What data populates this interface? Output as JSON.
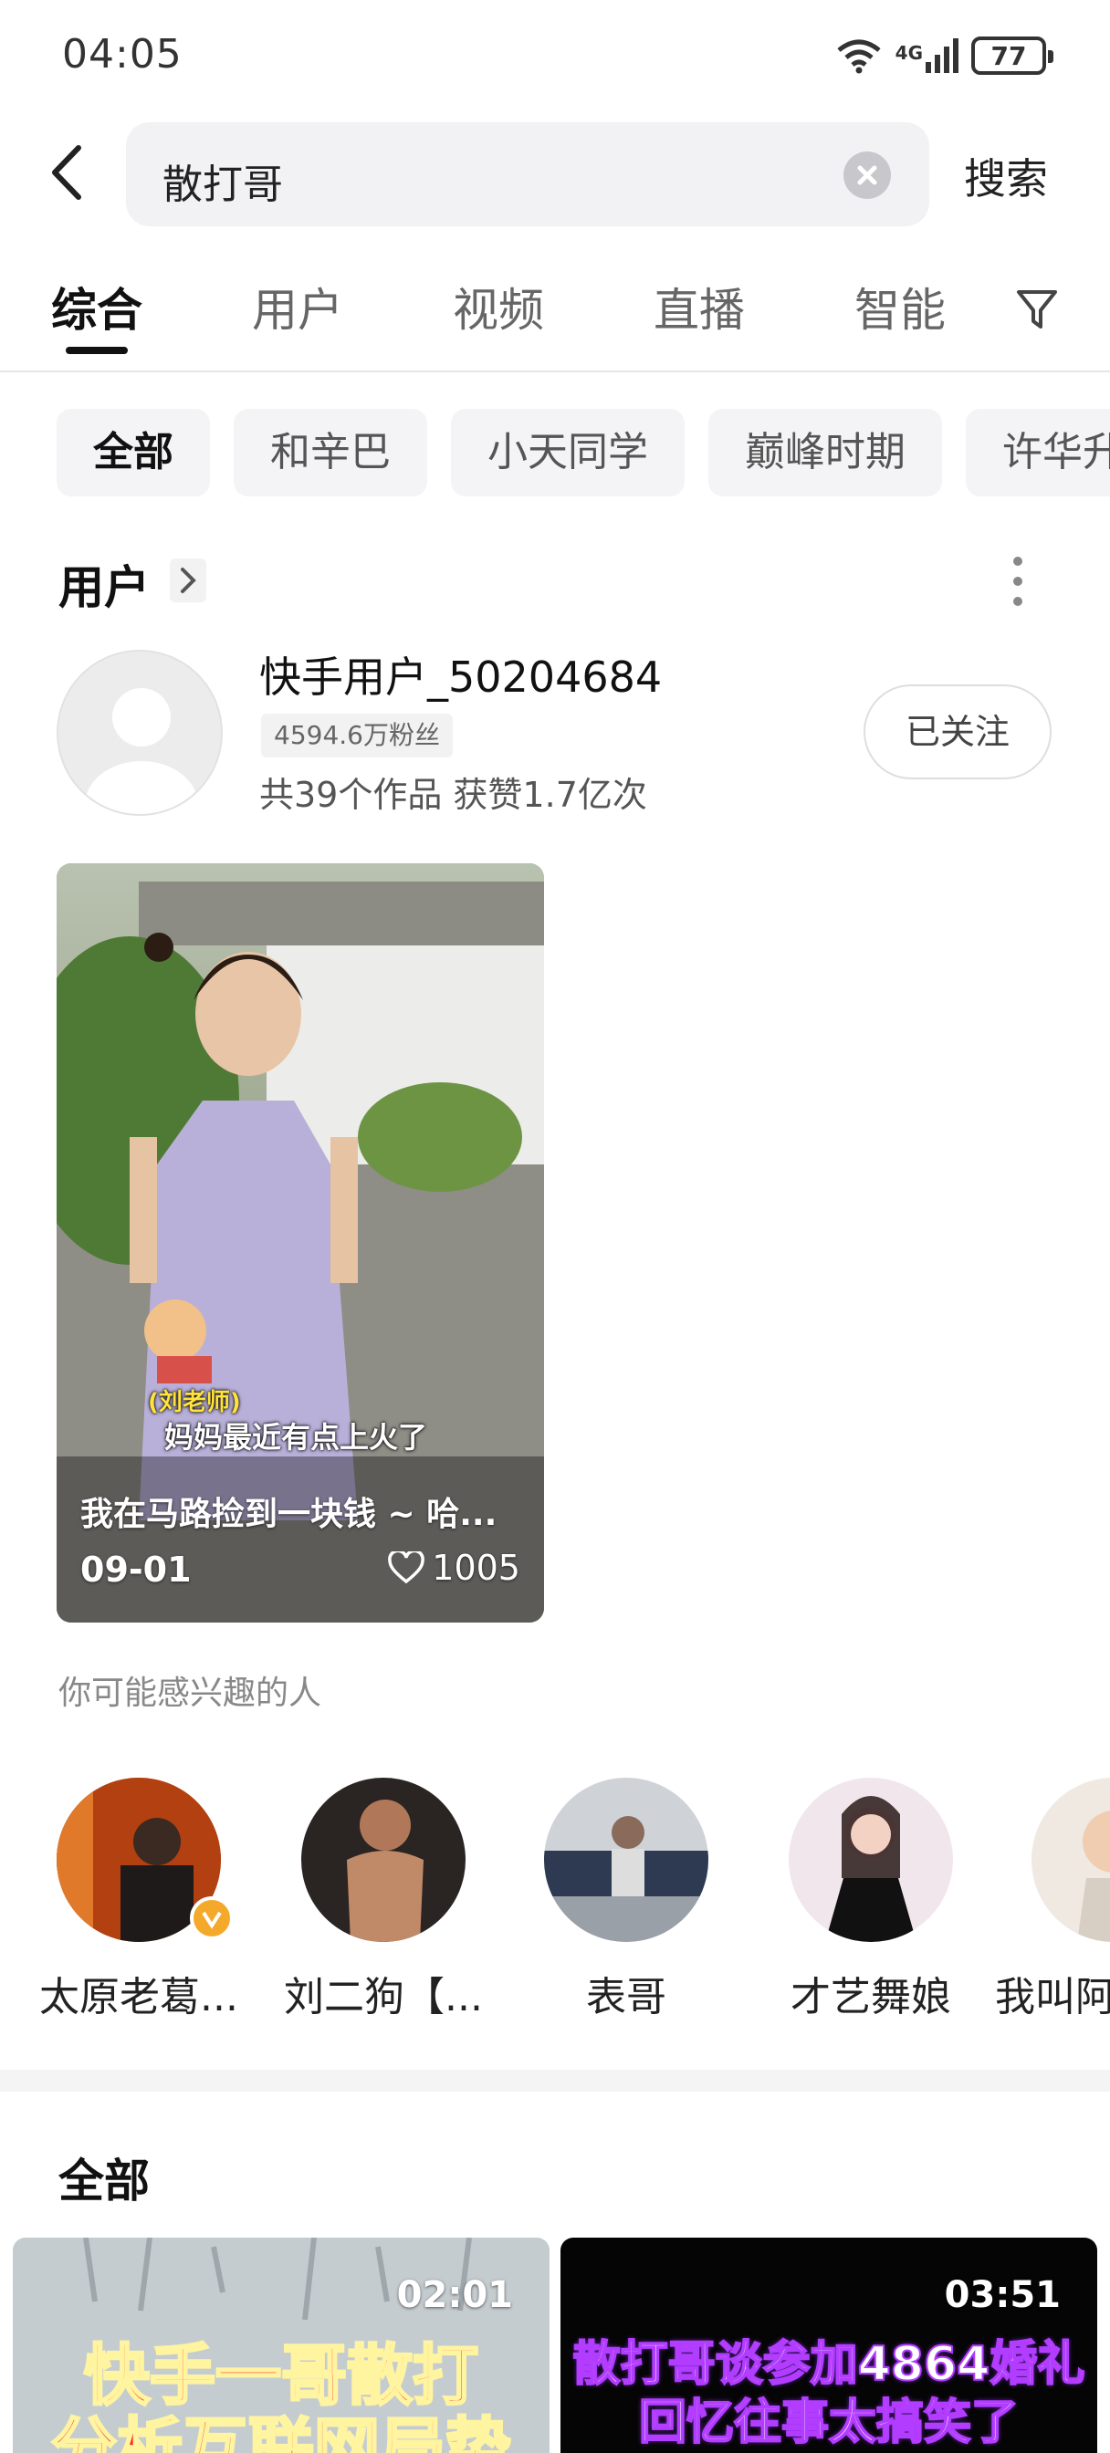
{
  "status_bar": {
    "time": "04:05",
    "network": "4G",
    "battery": "77"
  },
  "search": {
    "query": "散打哥",
    "submit_label": "搜索"
  },
  "tabs": [
    {
      "label": "综合"
    },
    {
      "label": "用户"
    },
    {
      "label": "视频"
    },
    {
      "label": "直播"
    },
    {
      "label": "智能"
    }
  ],
  "chips": [
    "全部",
    "和辛巴",
    "小天同学",
    "巅峰时期",
    "许华升"
  ],
  "user_section": {
    "title": "用户",
    "user": {
      "name": "快手用户_50204684",
      "fans": "4594.6万粉丝",
      "stats": "共39个作品 获赞1.7亿次",
      "follow_label": "已关注"
    }
  },
  "video": {
    "title": "我在马路捡到一块钱 ~ 哈...",
    "date": "09-01",
    "likes": "1005",
    "subtitle_name": "(刘老师)",
    "subtitle": "妈妈最近有点上火了"
  },
  "recommend": {
    "title": "你可能感兴趣的人",
    "people": [
      {
        "name": "太原老葛...",
        "verified": true
      },
      {
        "name": "刘二狗【..."
      },
      {
        "name": "表哥"
      },
      {
        "name": "才艺舞娘"
      },
      {
        "name": "我叫阿"
      }
    ]
  },
  "all_section": {
    "title": "全部",
    "videos": [
      {
        "duration": "02:01",
        "caption1": "快手一哥散打",
        "caption2": "分析互联网局势"
      },
      {
        "duration": "03:51",
        "caption1": "散打哥谈参加4864婚礼",
        "caption2": "回忆往事太搞笑了"
      }
    ]
  }
}
